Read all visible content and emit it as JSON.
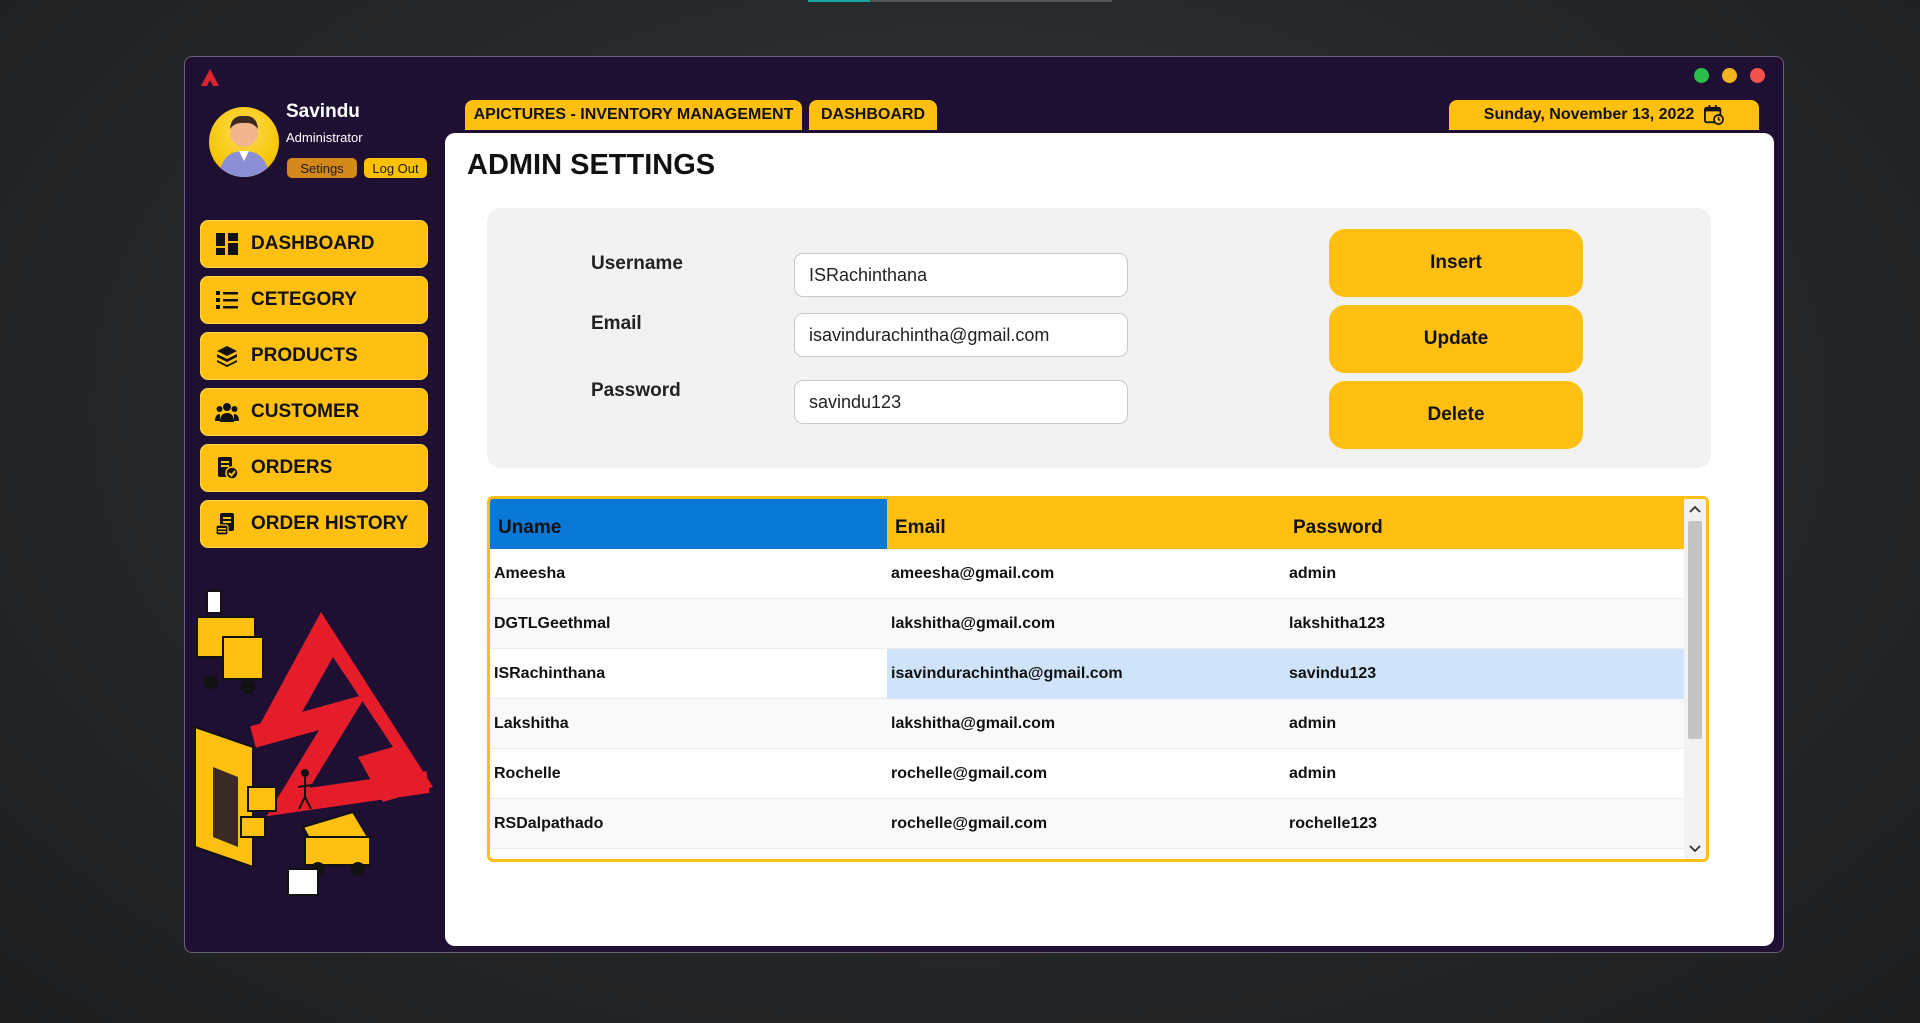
{
  "window": {
    "controls": [
      {
        "name": "maximize",
        "color": "#2bbd4a"
      },
      {
        "name": "minimize",
        "color": "#f1b51f"
      },
      {
        "name": "close",
        "color": "#f4524d"
      }
    ]
  },
  "profile": {
    "name": "Savindu",
    "role": "Administrator",
    "settings_label": "Setings",
    "logout_label": "Log Out"
  },
  "nav": [
    {
      "label": "DASHBOARD",
      "icon": "dashboard-icon"
    },
    {
      "label": "CETEGORY",
      "icon": "list-icon"
    },
    {
      "label": "PRODUCTS",
      "icon": "boxes-icon"
    },
    {
      "label": "CUSTOMER",
      "icon": "users-icon"
    },
    {
      "label": "ORDERS",
      "icon": "orders-icon"
    },
    {
      "label": "ORDER HISTORY",
      "icon": "order-history-icon"
    }
  ],
  "tabs": {
    "title": "APICTURES - INVENTORY MANAGEMENT",
    "current": "DASHBOARD",
    "date": "Sunday, November 13, 2022"
  },
  "page": {
    "title": "ADMIN SETTINGS"
  },
  "form": {
    "username_label": "Username",
    "username_value": "ISRachinthana",
    "email_label": "Email",
    "email_value": "isavindurachintha@gmail.com",
    "password_label": "Password",
    "password_value": "savindu123",
    "insert_label": "Insert",
    "update_label": "Update",
    "delete_label": "Delete"
  },
  "table": {
    "columns": [
      "Uname",
      "Email",
      "Password"
    ],
    "rows": [
      [
        "Ameesha",
        "ameesha@gmail.com",
        "admin"
      ],
      [
        "DGTLGeethmal",
        "lakshitha@gmail.com",
        "lakshitha123"
      ],
      [
        "ISRachinthana",
        "isavindurachintha@gmail.com",
        "savindu123"
      ],
      [
        "Lakshitha",
        "lakshitha@gmail.com",
        "admin"
      ],
      [
        "Rochelle",
        "rochelle@gmail.com",
        "admin"
      ],
      [
        "RSDalpathado",
        "rochelle@gmail.com",
        "rochelle123"
      ]
    ],
    "selected_row": 2
  },
  "colors": {
    "accent": "#ffc012",
    "sidebar_bg": "#1f0f33",
    "header_selected": "#0a78d7",
    "row_selected": "#cfe4fb"
  }
}
